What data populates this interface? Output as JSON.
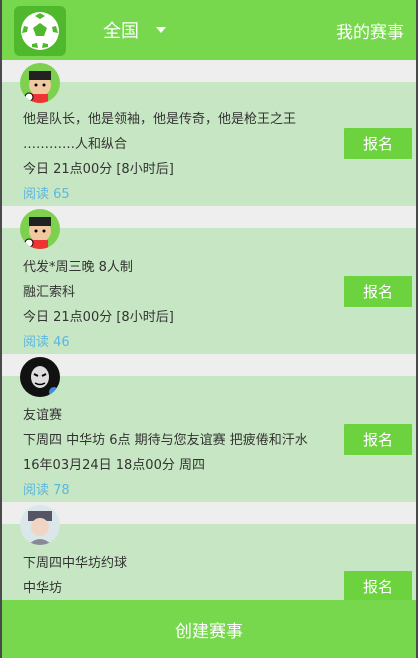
{
  "header": {
    "region": "全国",
    "my_matches": "我的赛事"
  },
  "items": [
    {
      "line1": "他是队长，他是领袖，他是传奇，他是枪王之王",
      "line2": "…………人和纵合",
      "time": "今日 21点00分 [8小时后]",
      "reads": "阅读 65",
      "action": "报名"
    },
    {
      "line1": "代发*周三晚 8人制",
      "line2": "融汇索科",
      "time": "今日 21点00分 [8小时后]",
      "reads": "阅读 46",
      "action": "报名"
    },
    {
      "line1": "友谊赛",
      "line2": "下周四 中华坊 6点 期待与您友谊赛 把疲倦和汗水",
      "time": "16年03月24日 18点00分 周四",
      "reads": "阅读 78",
      "action": "报名"
    },
    {
      "line1": "下周四中华坊约球",
      "line2": "中华坊",
      "action": "报名"
    }
  ],
  "footer": {
    "create": "创建赛事"
  }
}
